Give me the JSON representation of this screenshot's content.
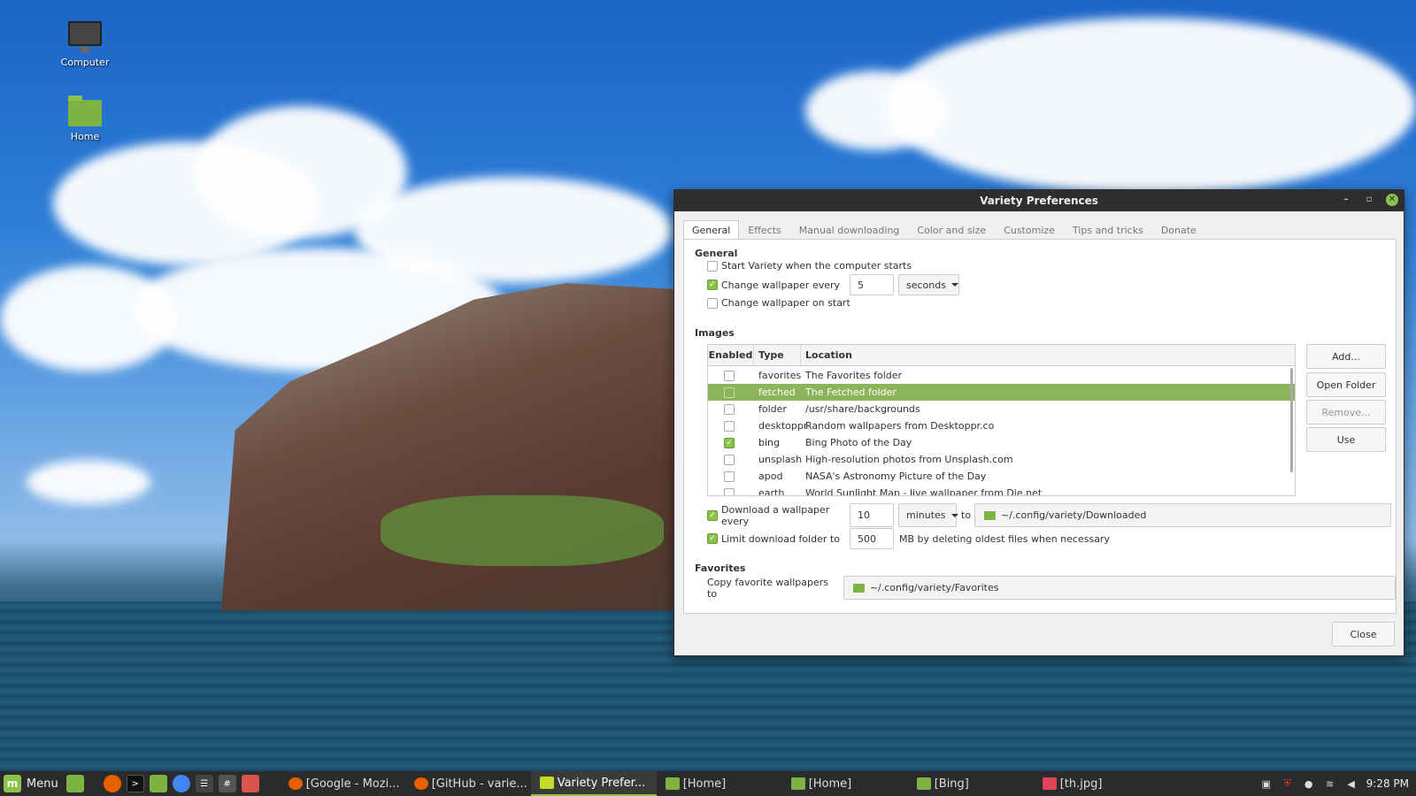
{
  "desktop": {
    "icons": [
      {
        "label": "Computer",
        "icon": "computer-icon"
      },
      {
        "label": "Home",
        "icon": "home-folder-icon"
      }
    ]
  },
  "window": {
    "title": "Variety Preferences",
    "controls": {
      "minimize": "–",
      "maximize": "▫",
      "close": "✕"
    },
    "tabs": [
      "General",
      "Effects",
      "Manual downloading",
      "Color and size",
      "Customize",
      "Tips and tricks",
      "Donate"
    ],
    "active_tab": "General",
    "general": {
      "heading": "General",
      "start_on_boot": {
        "label": "Start Variety when the computer starts",
        "checked": false
      },
      "change_every": {
        "label": "Change wallpaper every",
        "checked": true,
        "value": "5",
        "unit": "seconds"
      },
      "change_on_start": {
        "label": "Change wallpaper on start",
        "checked": false
      }
    },
    "images": {
      "heading": "Images",
      "columns": [
        "Enabled",
        "Type",
        "Location"
      ],
      "rows": [
        {
          "enabled": false,
          "type": "favorites",
          "location": "The Favorites folder"
        },
        {
          "enabled": false,
          "type": "fetched",
          "location": "The Fetched folder",
          "selected": true
        },
        {
          "enabled": false,
          "type": "folder",
          "location": "/usr/share/backgrounds"
        },
        {
          "enabled": false,
          "type": "desktoppr",
          "location": "Random wallpapers from Desktoppr.co"
        },
        {
          "enabled": true,
          "type": "bing",
          "location": "Bing Photo of the Day"
        },
        {
          "enabled": false,
          "type": "unsplash",
          "location": "High-resolution photos from Unsplash.com"
        },
        {
          "enabled": false,
          "type": "apod",
          "location": "NASA's Astronomy Picture of the Day"
        },
        {
          "enabled": false,
          "type": "earth",
          "location": "World Sunlight Map - live wallpaper from Die.net"
        }
      ],
      "buttons": {
        "add": "Add...",
        "open_folder": "Open Folder",
        "remove": "Remove...",
        "use": "Use"
      },
      "download": {
        "label": "Download a wallpaper every",
        "checked": true,
        "value": "10",
        "unit": "minutes",
        "to_label": "to",
        "path": "~/.config/variety/Downloaded"
      },
      "limit": {
        "label": "Limit download folder to",
        "checked": true,
        "value": "500",
        "suffix": "MB by deleting oldest files when necessary"
      }
    },
    "favorites": {
      "heading": "Favorites",
      "label": "Copy favorite wallpapers to",
      "path": "~/.config/variety/Favorites"
    },
    "close_label": "Close"
  },
  "taskbar": {
    "menu_label": "Menu",
    "tasks": [
      {
        "label": "[Google - Mozi...",
        "icon": "firefox-icon"
      },
      {
        "label": "[GitHub - varie...",
        "icon": "firefox-icon"
      },
      {
        "label": "Variety Prefer...",
        "icon": "variety-icon",
        "active": true
      },
      {
        "label": "[Home]",
        "icon": "folder-icon"
      },
      {
        "label": "[Home]",
        "icon": "folder-icon"
      },
      {
        "label": "[Bing]",
        "icon": "folder-icon"
      },
      {
        "label": "[th.jpg]",
        "icon": "image-viewer-icon"
      }
    ],
    "clock": "9:28 PM"
  },
  "colors": {
    "accent": "#8bc34a",
    "selection": "#8cb45a",
    "titlebar": "#2e2e2e",
    "taskbar": "#2b2b2b"
  }
}
